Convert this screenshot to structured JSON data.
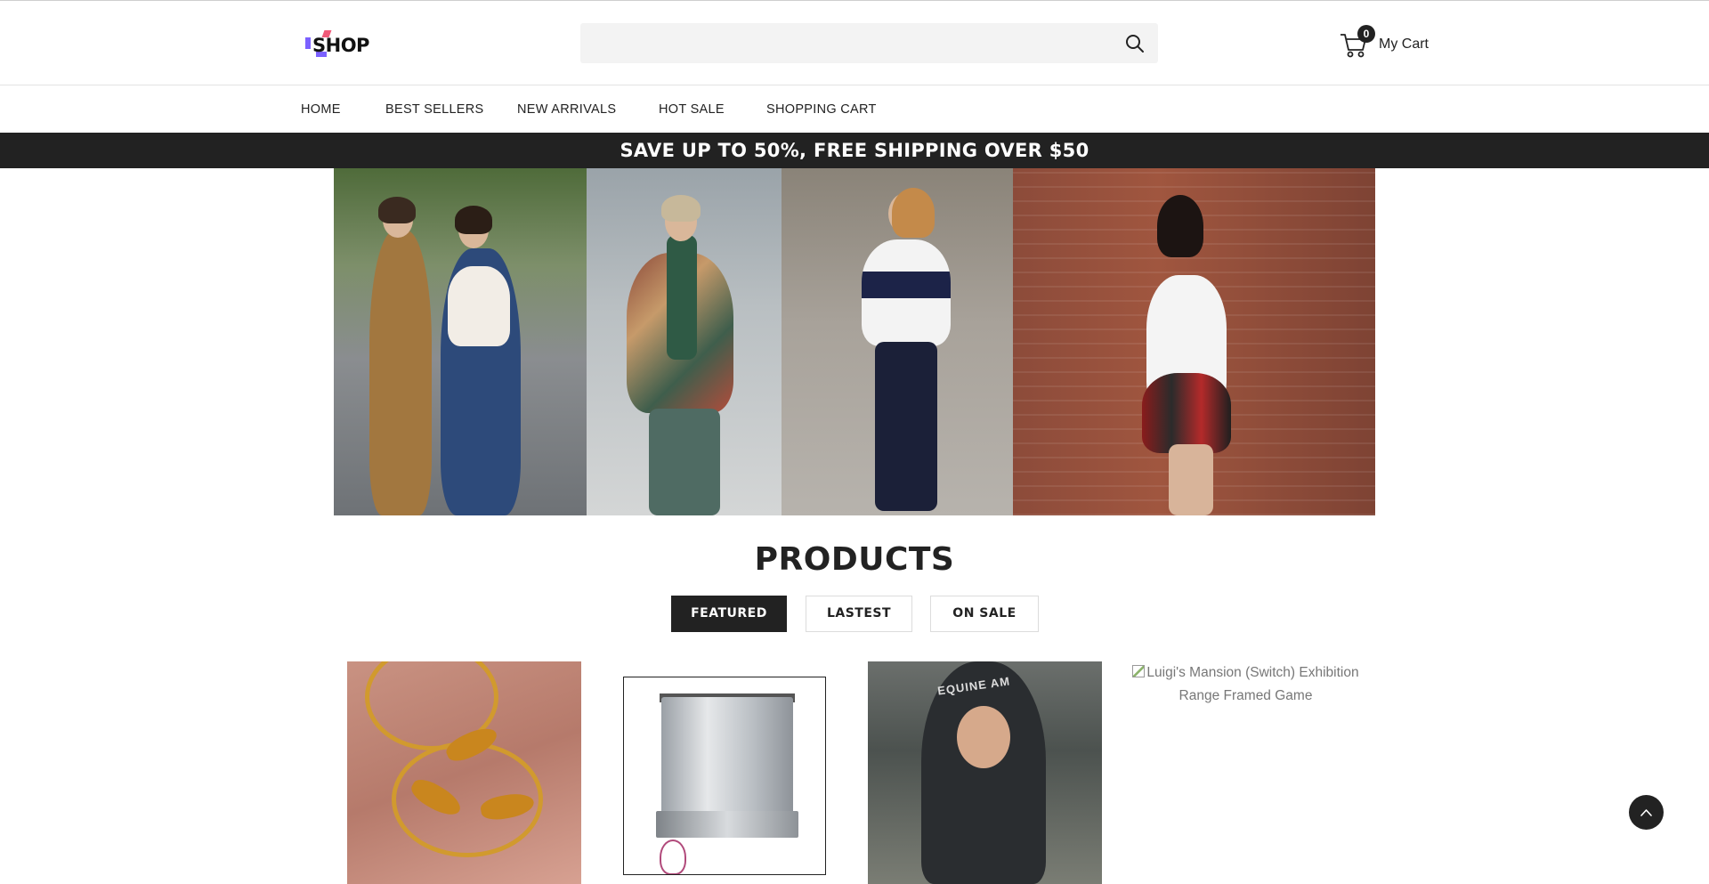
{
  "brand": {
    "logo_text": "SHOP"
  },
  "search": {
    "placeholder": "",
    "value": ""
  },
  "cart": {
    "count": "0",
    "label": "My Cart"
  },
  "nav": {
    "items": [
      {
        "label": "HOME"
      },
      {
        "label": "BEST SELLERS"
      },
      {
        "label": "NEW ARRIVALS"
      },
      {
        "label": "HOT SALE"
      },
      {
        "label": "SHOPPING CART"
      }
    ]
  },
  "promo": {
    "text": "SAVE UP TO 50%, FREE SHIPPING OVER $50"
  },
  "products": {
    "title": "PRODUCTS",
    "tabs": [
      {
        "label": "FEATURED",
        "active": true
      },
      {
        "label": "LASTEST",
        "active": false
      },
      {
        "label": "ON SALE",
        "active": false
      }
    ],
    "items": [
      {
        "image": "gold-fish-ring-photo"
      },
      {
        "image": "espresso-machine-photo"
      },
      {
        "image": "hooded-jacket-photo",
        "print": "EQUINE AM"
      },
      {
        "image_alt": "Luigi's Mansion (Switch) Exhibition Range Framed Game"
      }
    ]
  },
  "icons": {
    "search": "search-icon",
    "cart": "cart-icon",
    "back_to_top": "chevron-up-icon"
  }
}
